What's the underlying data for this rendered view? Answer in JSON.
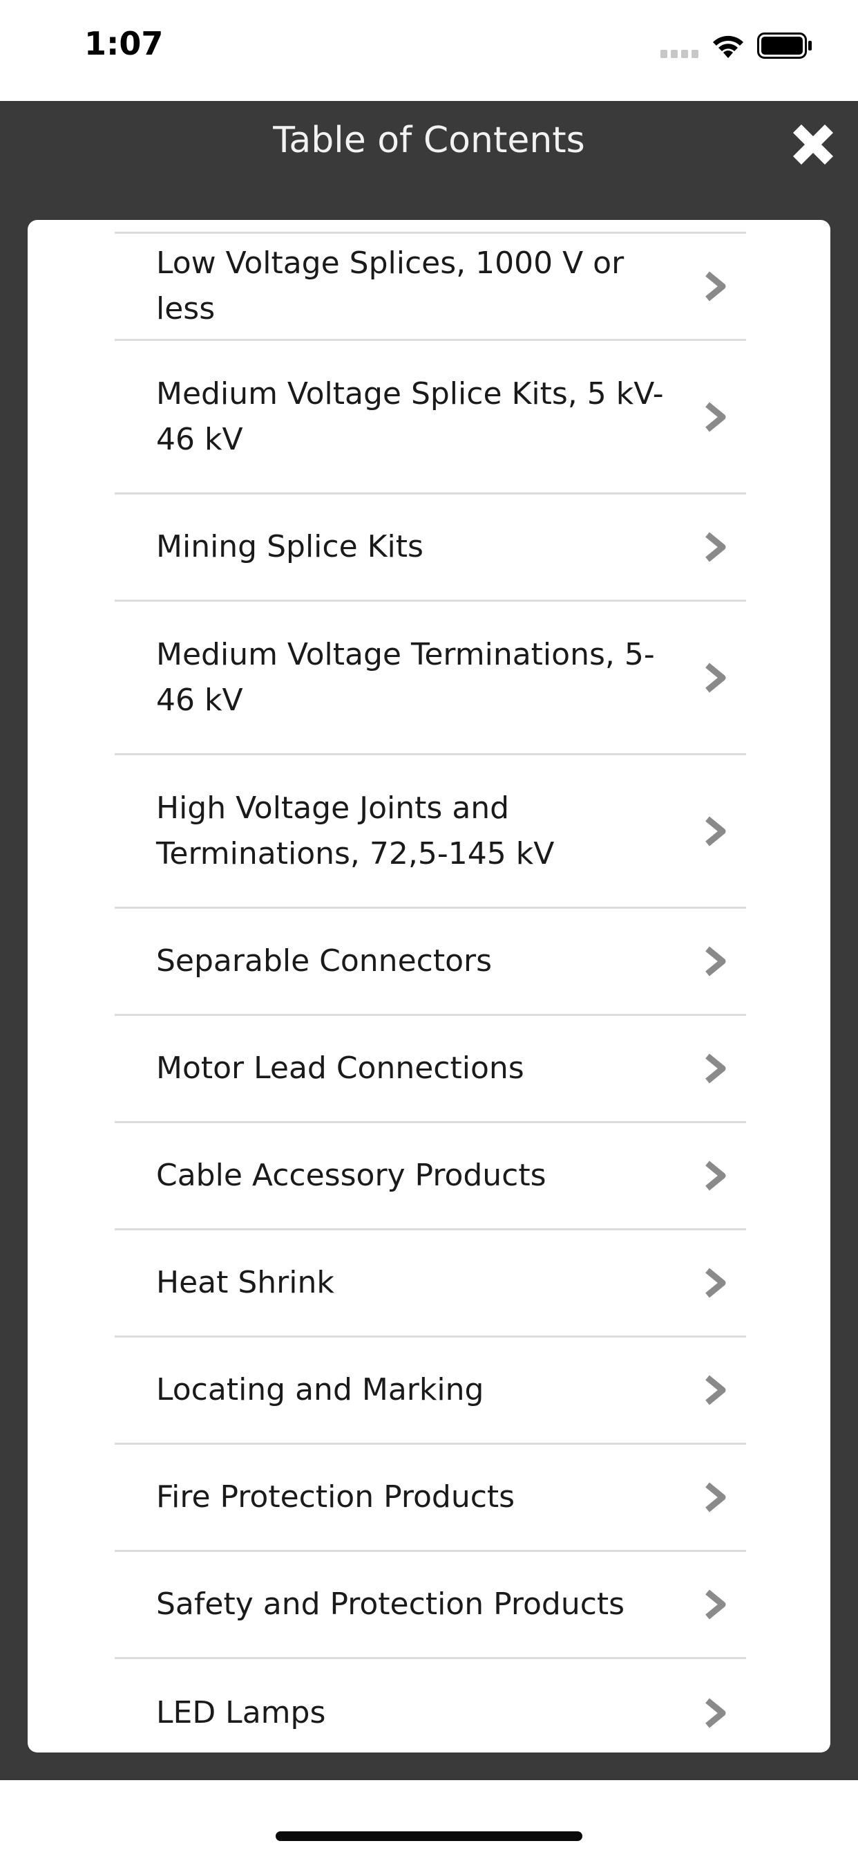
{
  "status_bar": {
    "time": "1:07",
    "icons": [
      "cellular-signal-icon",
      "wifi-icon",
      "battery-icon"
    ]
  },
  "header": {
    "title": "Table of Contents",
    "close_icon": "close-icon"
  },
  "colors": {
    "panel_background": "#3a3a3a",
    "card_background": "#ffffff",
    "divider": "#dcdcdc",
    "chevron": "#8a8a8a",
    "text": "#1a1a1a"
  },
  "items": [
    {
      "label": "Low Voltage Splices, 1000 V or less"
    },
    {
      "label": "Medium Voltage Splice Kits, 5 kV-46 kV"
    },
    {
      "label": "Mining Splice Kits"
    },
    {
      "label": "Medium Voltage Terminations, 5-46 kV"
    },
    {
      "label": "High Voltage Joints and Terminations, 72,5-145 kV"
    },
    {
      "label": "Separable Connectors"
    },
    {
      "label": "Motor Lead Connections"
    },
    {
      "label": "Cable Accessory Products"
    },
    {
      "label": "Heat Shrink"
    },
    {
      "label": "Locating and Marking"
    },
    {
      "label": "Fire Protection Products"
    },
    {
      "label": "Safety and Protection Products"
    },
    {
      "label": "LED Lamps"
    }
  ]
}
